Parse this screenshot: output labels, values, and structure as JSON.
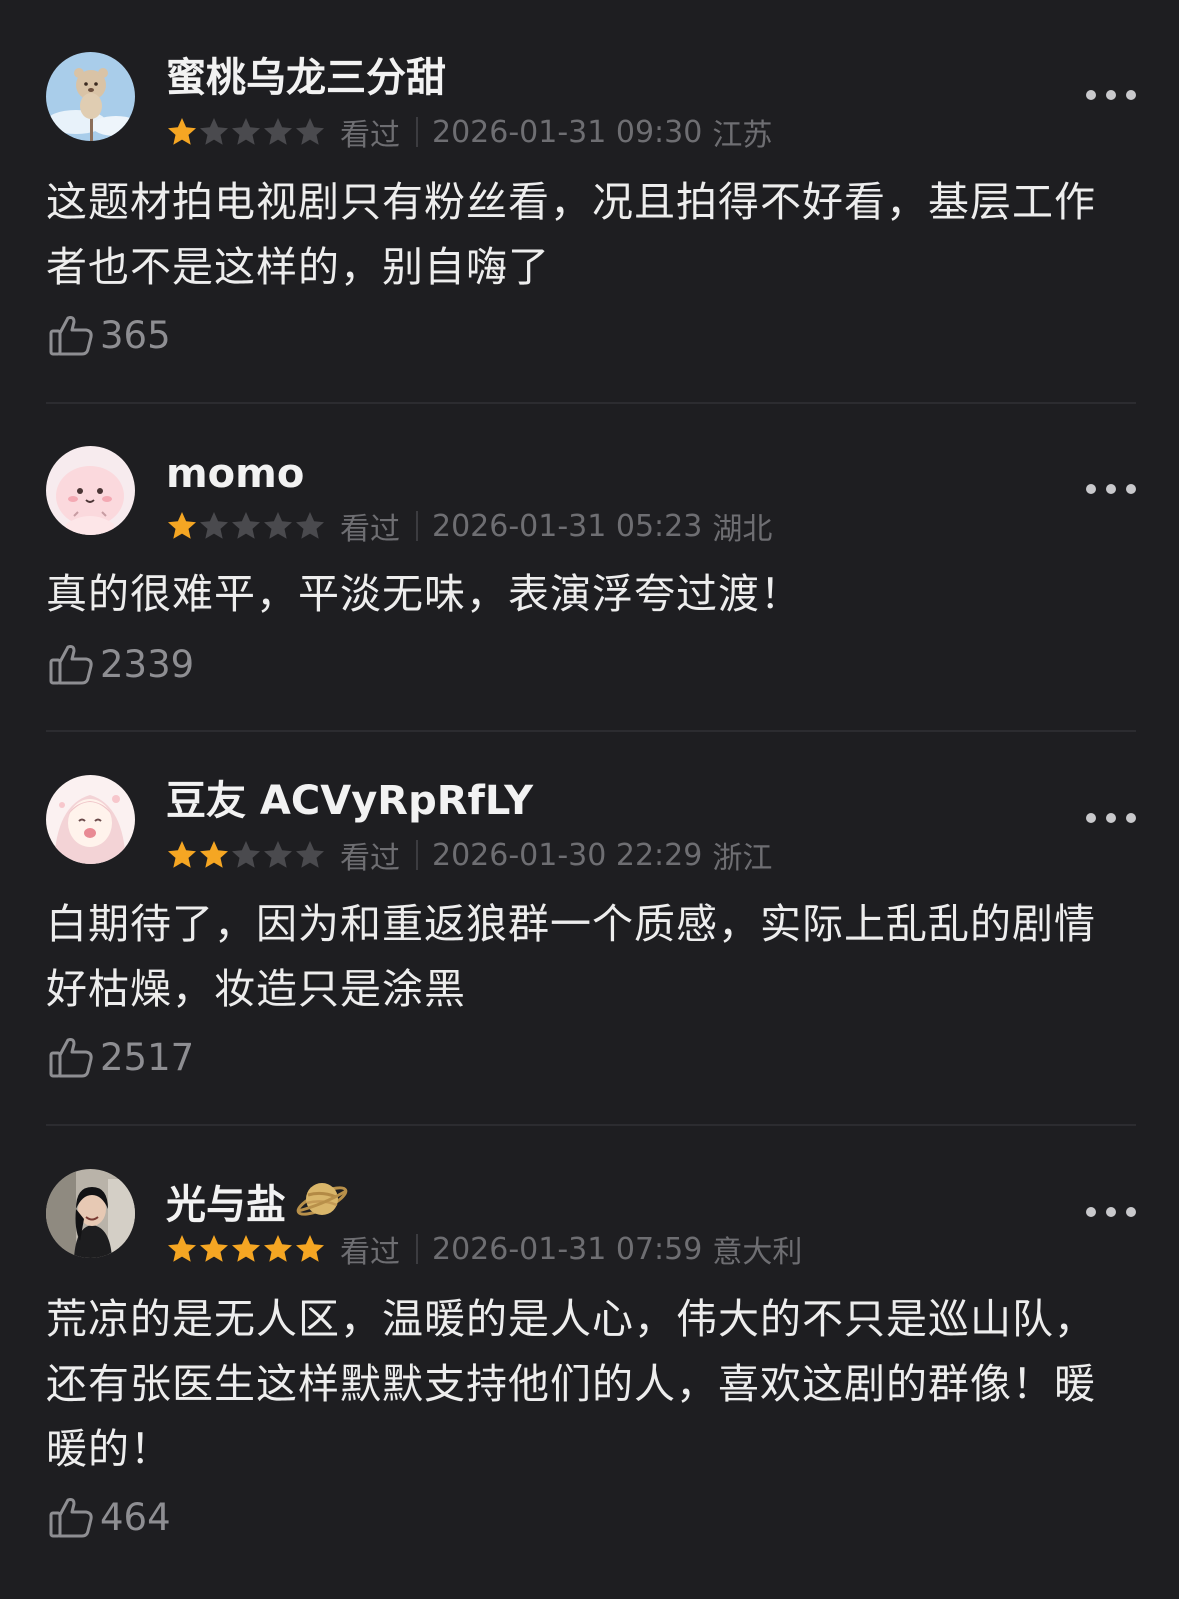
{
  "colors": {
    "background": "#1e1e21",
    "star_filled": "#f5a623",
    "star_empty": "#4a4a4e",
    "meta_text": "#6e6e72",
    "like_text": "#8e8e92"
  },
  "comments": [
    {
      "username": "蜜桃乌龙三分甜",
      "rating": 1,
      "max_rating": 5,
      "watched_label": "看过",
      "time": "2026-01-31 09:30",
      "location": "江苏",
      "text": "这题材拍电视剧只有粉丝看，况且拍得不好看，基层工作者也不是这样的，别自嗨了",
      "likes": "365",
      "avatar_icon": "avatar-bear-plush-sky"
    },
    {
      "username": "momo",
      "rating": 1,
      "max_rating": 5,
      "watched_label": "看过",
      "time": "2026-01-31 05:23",
      "location": "湖北",
      "text": "真的很难平，平淡无味，表演浮夸过渡！",
      "likes": "2339",
      "avatar_icon": "avatar-pink-blob"
    },
    {
      "username": "豆友 ACVyRpRfLY",
      "rating": 2,
      "max_rating": 5,
      "watched_label": "看过",
      "time": "2026-01-30 22:29",
      "location": "浙江",
      "text": "白期待了，因为和重返狼群一个质感，实际上乱乱的剧情好枯燥，妆造只是涂黑",
      "likes": "2517",
      "avatar_icon": "avatar-anime-girl"
    },
    {
      "username": "光与盐",
      "badge_icon": "planet-badge-icon",
      "rating": 5,
      "max_rating": 5,
      "watched_label": "看过",
      "time": "2026-01-31 07:59",
      "location": "意大利",
      "text": "荒凉的是无人区，温暖的是人心，伟大的不只是巡山队，还有张医生这样默默支持他们的人，喜欢这剧的群像！暖暖的！",
      "likes": "464",
      "avatar_icon": "avatar-photo-person"
    }
  ]
}
